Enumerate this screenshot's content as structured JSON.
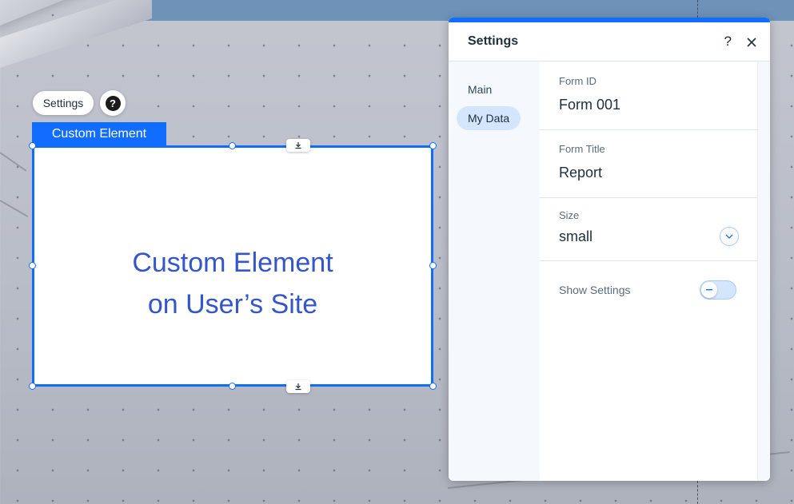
{
  "canvas": {
    "toolbar": {
      "settings_label": "Settings",
      "help_label": "?"
    },
    "element": {
      "tag_label": "Custom Element",
      "text_line1": "Custom Element",
      "text_line2": "on User’s Site"
    }
  },
  "panel": {
    "title": "Settings",
    "help_label": "?",
    "tabs": [
      {
        "label": "Main",
        "active": false
      },
      {
        "label": "My Data",
        "active": true
      }
    ],
    "fields": {
      "form_id": {
        "label": "Form ID",
        "value": "Form 001"
      },
      "form_title": {
        "label": "Form Title",
        "value": "Report"
      },
      "size": {
        "label": "Size",
        "value": "small"
      },
      "show_settings": {
        "label": "Show Settings",
        "checked": false
      }
    }
  },
  "colors": {
    "accent": "#116dff",
    "element_text": "#3556c8",
    "active_tab": "#d4e6fd"
  }
}
